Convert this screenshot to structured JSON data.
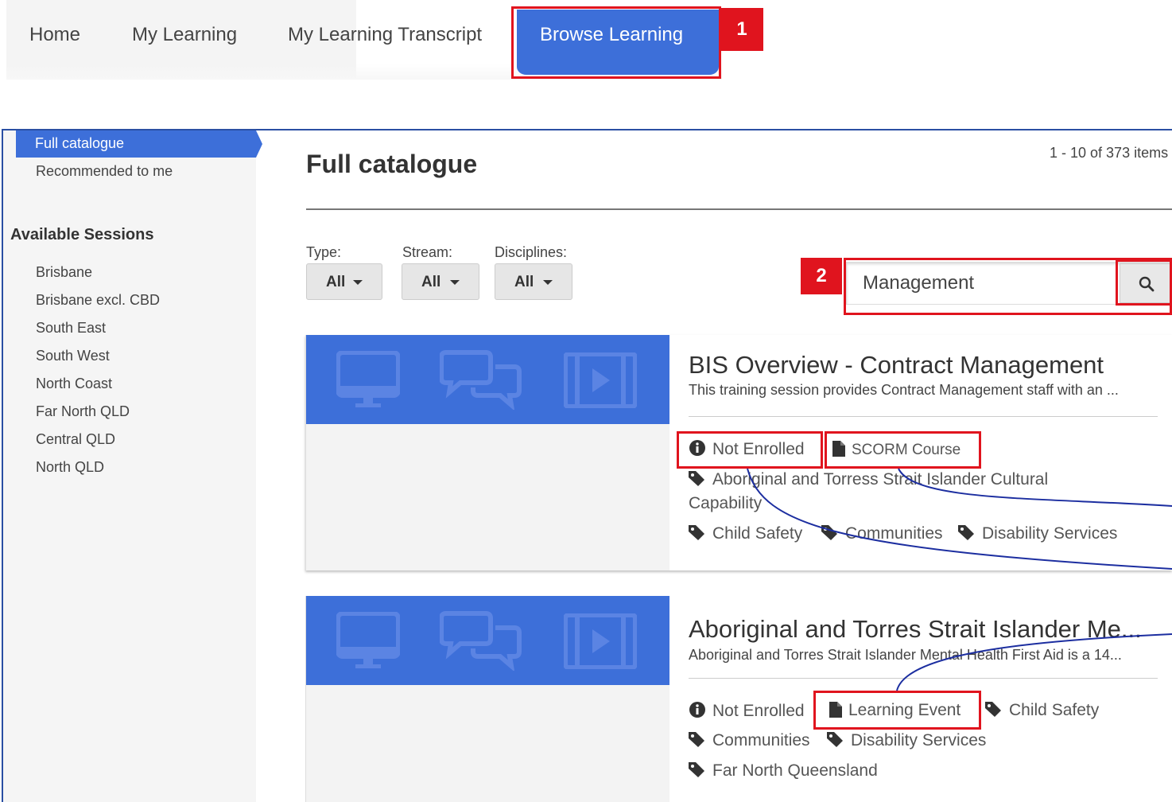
{
  "nav": {
    "items": [
      "Home",
      "My Learning",
      "My Learning Transcript"
    ],
    "active": "Browse Learning"
  },
  "callouts": [
    "1",
    "2"
  ],
  "sidebar": {
    "catalogue_links": [
      "Full catalogue",
      "Recommended to me"
    ],
    "sessions_heading": "Available Sessions",
    "sessions": [
      "Brisbane",
      "Brisbane excl. CBD",
      "South East",
      "South West",
      "North Coast",
      "Far North QLD",
      "Central QLD",
      "North QLD"
    ]
  },
  "main": {
    "title": "Full catalogue",
    "count": "1 - 10 of 373 items",
    "filters": [
      {
        "label": "Type:",
        "value": "All"
      },
      {
        "label": "Stream:",
        "value": "All"
      },
      {
        "label": "Disciplines:",
        "value": "All"
      }
    ],
    "search_value": "Management"
  },
  "cards": [
    {
      "title": "BIS Overview - Contract Management",
      "desc": "This training session provides Contract Management staff with an ...",
      "status": "Not Enrolled",
      "kind": "SCORM Course",
      "tags": [
        "Aboriginal and Torress Strait Islander Cultural",
        "Capability",
        "Child Safety",
        "Communities",
        "Disability Services"
      ]
    },
    {
      "title": "Aboriginal and Torres Strait Islander Me...",
      "desc": "Aboriginal and Torres Strait Islander Mental Health First Aid is a 14...",
      "status": "Not Enrolled",
      "kind": "Learning Event",
      "tags": [
        "Child Safety",
        "Communities",
        "Disability Services",
        "Far North Queensland"
      ]
    }
  ],
  "colors": {
    "accent": "#3d6fd9",
    "callout": "#e0141e",
    "connector": "#1c2ea0"
  }
}
